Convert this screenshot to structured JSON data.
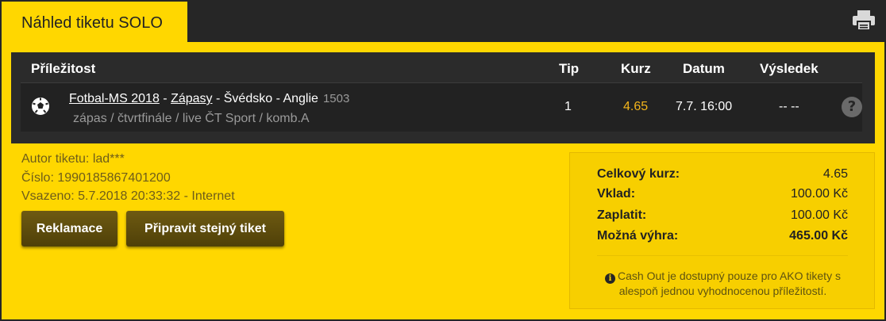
{
  "header": {
    "tab_title": "Náhled tiketu SOLO"
  },
  "table": {
    "columns": {
      "opportunity": "Příležitost",
      "tip": "Tip",
      "odds": "Kurz",
      "date": "Datum",
      "result": "Výsledek"
    },
    "rows": [
      {
        "sport_link": "Fotbal-MS 2018",
        "sep1": " - ",
        "category_link": "Zápasy",
        "match_name": " - Švédsko - Anglie",
        "match_id": "1503",
        "details": "zápas / čtvrtfinále / live ČT Sport / komb.A",
        "tip": "1",
        "odds": "4.65",
        "date": "7.7. 16:00",
        "result": "-- --",
        "help": "?"
      }
    ]
  },
  "ticket_info": {
    "author": "Autor tiketu: lad***",
    "number": "Číslo: 1990185867401200",
    "placed": "Vsazeno: 5.7.2018 20:33:32 - Internet"
  },
  "buttons": {
    "claim": "Reklamace",
    "prepare_same": "Připravit stejný tiket"
  },
  "summary": {
    "total_odds_label": "Celkový kurz:",
    "total_odds": "4.65",
    "stake_label": "Vklad:",
    "stake": "100.00 Kč",
    "pay_label": "Zaplatit:",
    "pay": "100.00 Kč",
    "win_label": "Možná výhra:",
    "win": "465.00 Kč",
    "cashout_note": "Cash Out je dostupný pouze pro AKO tikety s alespoň jednou vyhodnocenou příležitostí."
  },
  "colors": {
    "brand_yellow": "#ffd700",
    "dark": "#262626",
    "odds_accent": "#f3b51b"
  },
  "icons": {
    "print": "printer-icon",
    "ball": "soccer-ball-icon",
    "help": "help-icon",
    "info": "info-icon"
  }
}
